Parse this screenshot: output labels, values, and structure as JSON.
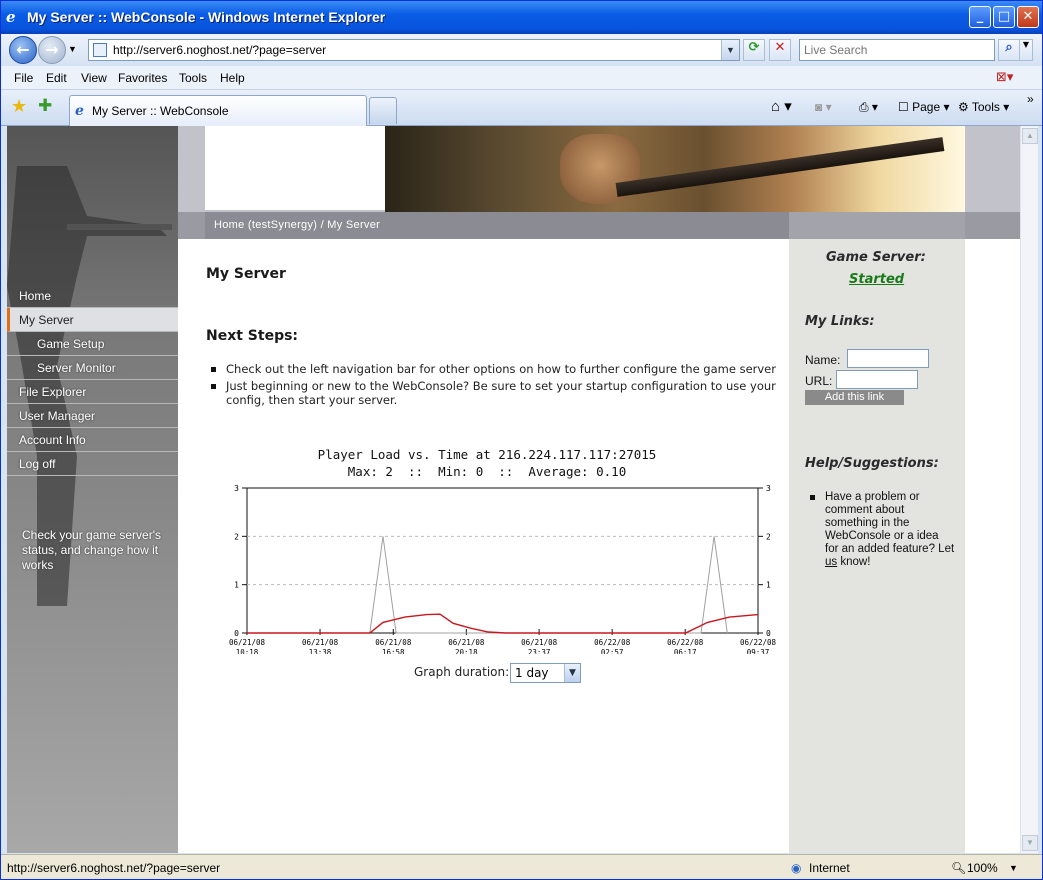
{
  "window": {
    "title": "My Server :: WebConsole - Windows Internet Explorer"
  },
  "browser": {
    "address": "http://server6.noghost.net/?page=server",
    "search_placeholder": "Live Search",
    "menu": [
      "File",
      "Edit",
      "View",
      "Favorites",
      "Tools",
      "Help"
    ],
    "tab_label": "My Server :: WebConsole",
    "toolbar": {
      "page_label": "Page",
      "tools_label": "Tools"
    },
    "status_url": "http://server6.noghost.net/?page=server",
    "zone": "Internet",
    "zoom": "100%"
  },
  "page": {
    "breadcrumb": "Home (testSynergy) / My Server",
    "nav": [
      {
        "label": "Home",
        "selected": false,
        "sub": false
      },
      {
        "label": "My Server",
        "selected": true,
        "sub": false
      },
      {
        "label": "Game Setup",
        "selected": false,
        "sub": true
      },
      {
        "label": "Server Monitor",
        "selected": false,
        "sub": true
      },
      {
        "label": "File Explorer",
        "selected": false,
        "sub": false
      },
      {
        "label": "User Manager",
        "selected": false,
        "sub": false
      },
      {
        "label": "Account Info",
        "selected": false,
        "sub": false
      },
      {
        "label": "Log off",
        "selected": false,
        "sub": false
      }
    ],
    "tagline": "Check your game server's status, and change how it works",
    "title": "My Server",
    "next_steps_heading": "Next Steps:",
    "next_steps": [
      "Check out the left navigation bar for other options on how to further configure the game server",
      "Just beginning or new to the WebConsole? Be sure to set your startup configuration to use your config, then start your server."
    ],
    "graph_duration_label": "Graph duration:",
    "graph_duration_value": "1 day"
  },
  "sidebar": {
    "game_server_label": "Game Server:",
    "game_server_status": "Started",
    "links_heading": "My Links:",
    "name_label": "Name:",
    "url_label": "URL:",
    "add_button": "Add this link",
    "help_heading": "Help/Suggestions:",
    "help_text_pre": "Have a problem or comment about something in the WebConsole or a idea for an added feature? Let",
    "help_link": "us",
    "help_text_post": "know!"
  },
  "chart_data": {
    "type": "line",
    "title": "Player Load vs. Time at 216.224.117.117:27015",
    "subtitle": "Max: 2  ::  Min: 0  ::  Average: 0.10",
    "ylim": [
      0,
      3
    ],
    "yticks": [
      0,
      1,
      2,
      3
    ],
    "xlim": [
      0,
      23.3
    ],
    "x_ticks": [
      {
        "x": 0,
        "date": "06/21/08",
        "time": "10:18"
      },
      {
        "x": 3.33,
        "date": "06/21/08",
        "time": "13:38"
      },
      {
        "x": 6.67,
        "date": "06/21/08",
        "time": "16:58"
      },
      {
        "x": 10.0,
        "date": "06/21/08",
        "time": "20:18"
      },
      {
        "x": 13.32,
        "date": "06/21/08",
        "time": "23:37"
      },
      {
        "x": 16.65,
        "date": "06/22/08",
        "time": "02:57"
      },
      {
        "x": 19.98,
        "date": "06/22/08",
        "time": "06:17"
      },
      {
        "x": 23.3,
        "date": "06/22/08",
        "time": "09:37"
      }
    ],
    "series": [
      {
        "color": "#a0a0a0",
        "points": [
          [
            5.6,
            0
          ],
          [
            6.2,
            2
          ],
          [
            6.8,
            0
          ],
          [
            20.7,
            0
          ],
          [
            21.3,
            2
          ],
          [
            21.9,
            0
          ]
        ]
      },
      {
        "color": "#c8181e",
        "points": [
          [
            0,
            0
          ],
          [
            5.6,
            0
          ],
          [
            6.2,
            0.22
          ],
          [
            7.2,
            0.33
          ],
          [
            8.2,
            0.38
          ],
          [
            8.8,
            0.39
          ],
          [
            9.4,
            0.2
          ],
          [
            10.2,
            0.1
          ],
          [
            11.0,
            0.02
          ],
          [
            11.8,
            0
          ],
          [
            20.0,
            0
          ],
          [
            21.0,
            0.22
          ],
          [
            22.0,
            0.33
          ],
          [
            23.3,
            0.38
          ]
        ]
      }
    ],
    "grid": true
  }
}
